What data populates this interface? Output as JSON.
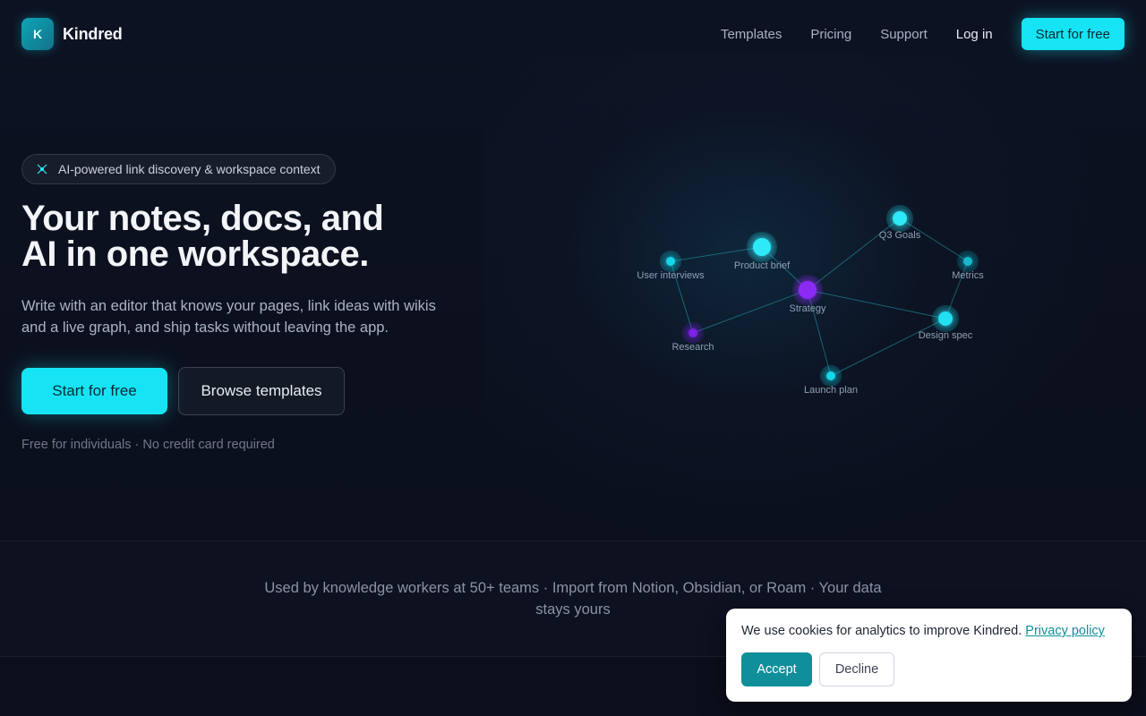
{
  "brand": {
    "logo_letter": "K",
    "name": "Kindred",
    "accent_color": "#16e4f5"
  },
  "nav": {
    "links": [
      {
        "label": "Templates"
      },
      {
        "label": "Pricing"
      },
      {
        "label": "Support"
      }
    ],
    "login_label": "Log in",
    "cta_label": "Start for free"
  },
  "hero": {
    "badge_icon": "sparkle-network-icon",
    "badge_text": "AI-powered link discovery & workspace context",
    "title_line1": "Your notes, docs, and",
    "title_line2": "AI in one workspace.",
    "subtitle": "Write with an editor that knows your pages, link ideas with wikis and a live graph, and ship tasks without leaving the app.",
    "primary_cta": "Start for free",
    "secondary_cta": "Browse templates",
    "note": "Free for individuals · No credit card required"
  },
  "graph": {
    "nodes": [
      {
        "id": "user-interviews",
        "label": "User interviews",
        "color": "#16d6ea",
        "importance": "small"
      },
      {
        "id": "product-brief",
        "label": "Product brief",
        "color": "#2ee9f7",
        "importance": "large"
      },
      {
        "id": "q3-goals",
        "label": "Q3 Goals",
        "color": "#2ee9f7",
        "importance": "medium"
      },
      {
        "id": "metrics",
        "label": "Metrics",
        "color": "#12b9cc",
        "importance": "small"
      },
      {
        "id": "strategy",
        "label": "Strategy",
        "color": "#8b2cf5",
        "importance": "large"
      },
      {
        "id": "design-spec",
        "label": "Design spec",
        "color": "#22dff2",
        "importance": "medium"
      },
      {
        "id": "research",
        "label": "Research",
        "color": "#7a22e6",
        "importance": "small"
      },
      {
        "id": "launch-plan",
        "label": "Launch plan",
        "color": "#16d6ea",
        "importance": "small"
      }
    ],
    "edges": [
      [
        "user-interviews",
        "product-brief"
      ],
      [
        "user-interviews",
        "research"
      ],
      [
        "product-brief",
        "strategy"
      ],
      [
        "strategy",
        "q3-goals"
      ],
      [
        "q3-goals",
        "metrics"
      ],
      [
        "metrics",
        "design-spec"
      ],
      [
        "strategy",
        "design-spec"
      ],
      [
        "strategy",
        "research"
      ],
      [
        "strategy",
        "launch-plan"
      ],
      [
        "launch-plan",
        "design-spec"
      ]
    ]
  },
  "trust": {
    "text": "Used by knowledge workers at 50+ teams · Import from Notion, Obsidian, or Roam · Your data stays yours"
  },
  "cookie": {
    "message": "We use cookies for analytics to improve Kindred.",
    "link_label": "Privacy policy",
    "accept_label": "Accept",
    "decline_label": "Decline"
  }
}
